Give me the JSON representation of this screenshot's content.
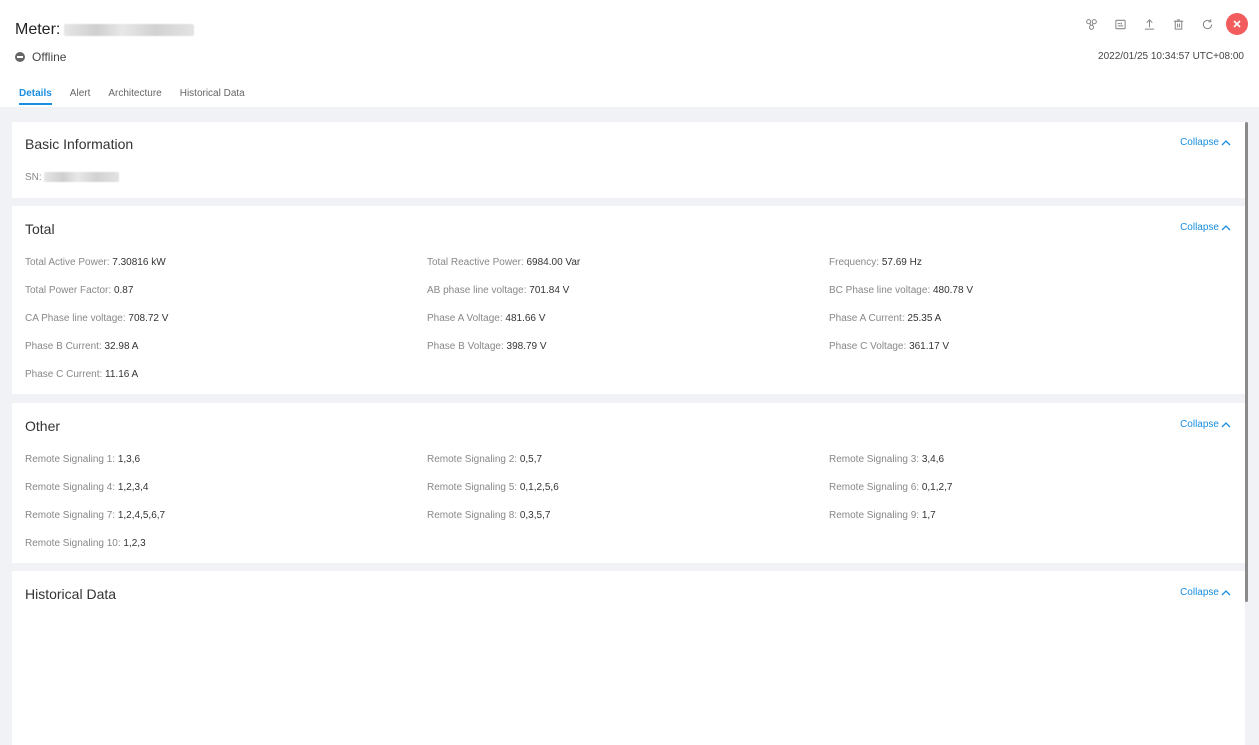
{
  "header": {
    "title_prefix": "Meter:",
    "status": "Offline",
    "timestamp": "2022/01/25 10:34:57 UTC+08:00",
    "tabs": [
      {
        "label": "Details",
        "active": true
      },
      {
        "label": "Alert",
        "active": false
      },
      {
        "label": "Architecture",
        "active": false
      },
      {
        "label": "Historical Data",
        "active": false
      }
    ],
    "toolbar_icons": [
      "topology-icon",
      "settings-panel-icon",
      "upload-icon",
      "delete-icon",
      "refresh-icon",
      "close-icon"
    ],
    "accent_color": "#1a8ee0",
    "close_color": "#f25c5c"
  },
  "basic": {
    "title": "Basic Information",
    "collapse": "Collapse",
    "sn_label": "SN:"
  },
  "total": {
    "title": "Total",
    "collapse": "Collapse",
    "fields": [
      {
        "label": "Total Active Power:",
        "value": "7.30816 kW"
      },
      {
        "label": "Total Reactive Power:",
        "value": "6984.00 Var"
      },
      {
        "label": "Frequency:",
        "value": "57.69 Hz"
      },
      {
        "label": "Total Power Factor:",
        "value": "0.87"
      },
      {
        "label": "AB phase line voltage:",
        "value": "701.84 V"
      },
      {
        "label": "BC Phase line voltage:",
        "value": "480.78 V"
      },
      {
        "label": "CA Phase line voltage:",
        "value": "708.72 V"
      },
      {
        "label": "Phase A Voltage:",
        "value": "481.66 V"
      },
      {
        "label": "Phase A Current:",
        "value": "25.35 A"
      },
      {
        "label": "Phase B Current:",
        "value": "32.98 A"
      },
      {
        "label": "Phase B Voltage:",
        "value": "398.79 V"
      },
      {
        "label": "Phase C Voltage:",
        "value": "361.17 V"
      },
      {
        "label": "Phase C Current:",
        "value": "11.16 A"
      }
    ]
  },
  "other": {
    "title": "Other",
    "collapse": "Collapse",
    "fields": [
      {
        "label": "Remote Signaling 1:",
        "value": "1,3,6"
      },
      {
        "label": "Remote Signaling 2:",
        "value": "0,5,7"
      },
      {
        "label": "Remote Signaling 3:",
        "value": "3,4,6"
      },
      {
        "label": "Remote Signaling 4:",
        "value": "1,2,3,4"
      },
      {
        "label": "Remote Signaling 5:",
        "value": "0,1,2,5,6"
      },
      {
        "label": "Remote Signaling 6:",
        "value": "0,1,2,7"
      },
      {
        "label": "Remote Signaling 7:",
        "value": "1,2,4,5,6,7"
      },
      {
        "label": "Remote Signaling 8:",
        "value": "0,3,5,7"
      },
      {
        "label": "Remote Signaling 9:",
        "value": "1,7"
      },
      {
        "label": "Remote Signaling 10:",
        "value": "1,2,3"
      }
    ]
  },
  "historical": {
    "title": "Historical Data",
    "collapse": "Collapse"
  }
}
